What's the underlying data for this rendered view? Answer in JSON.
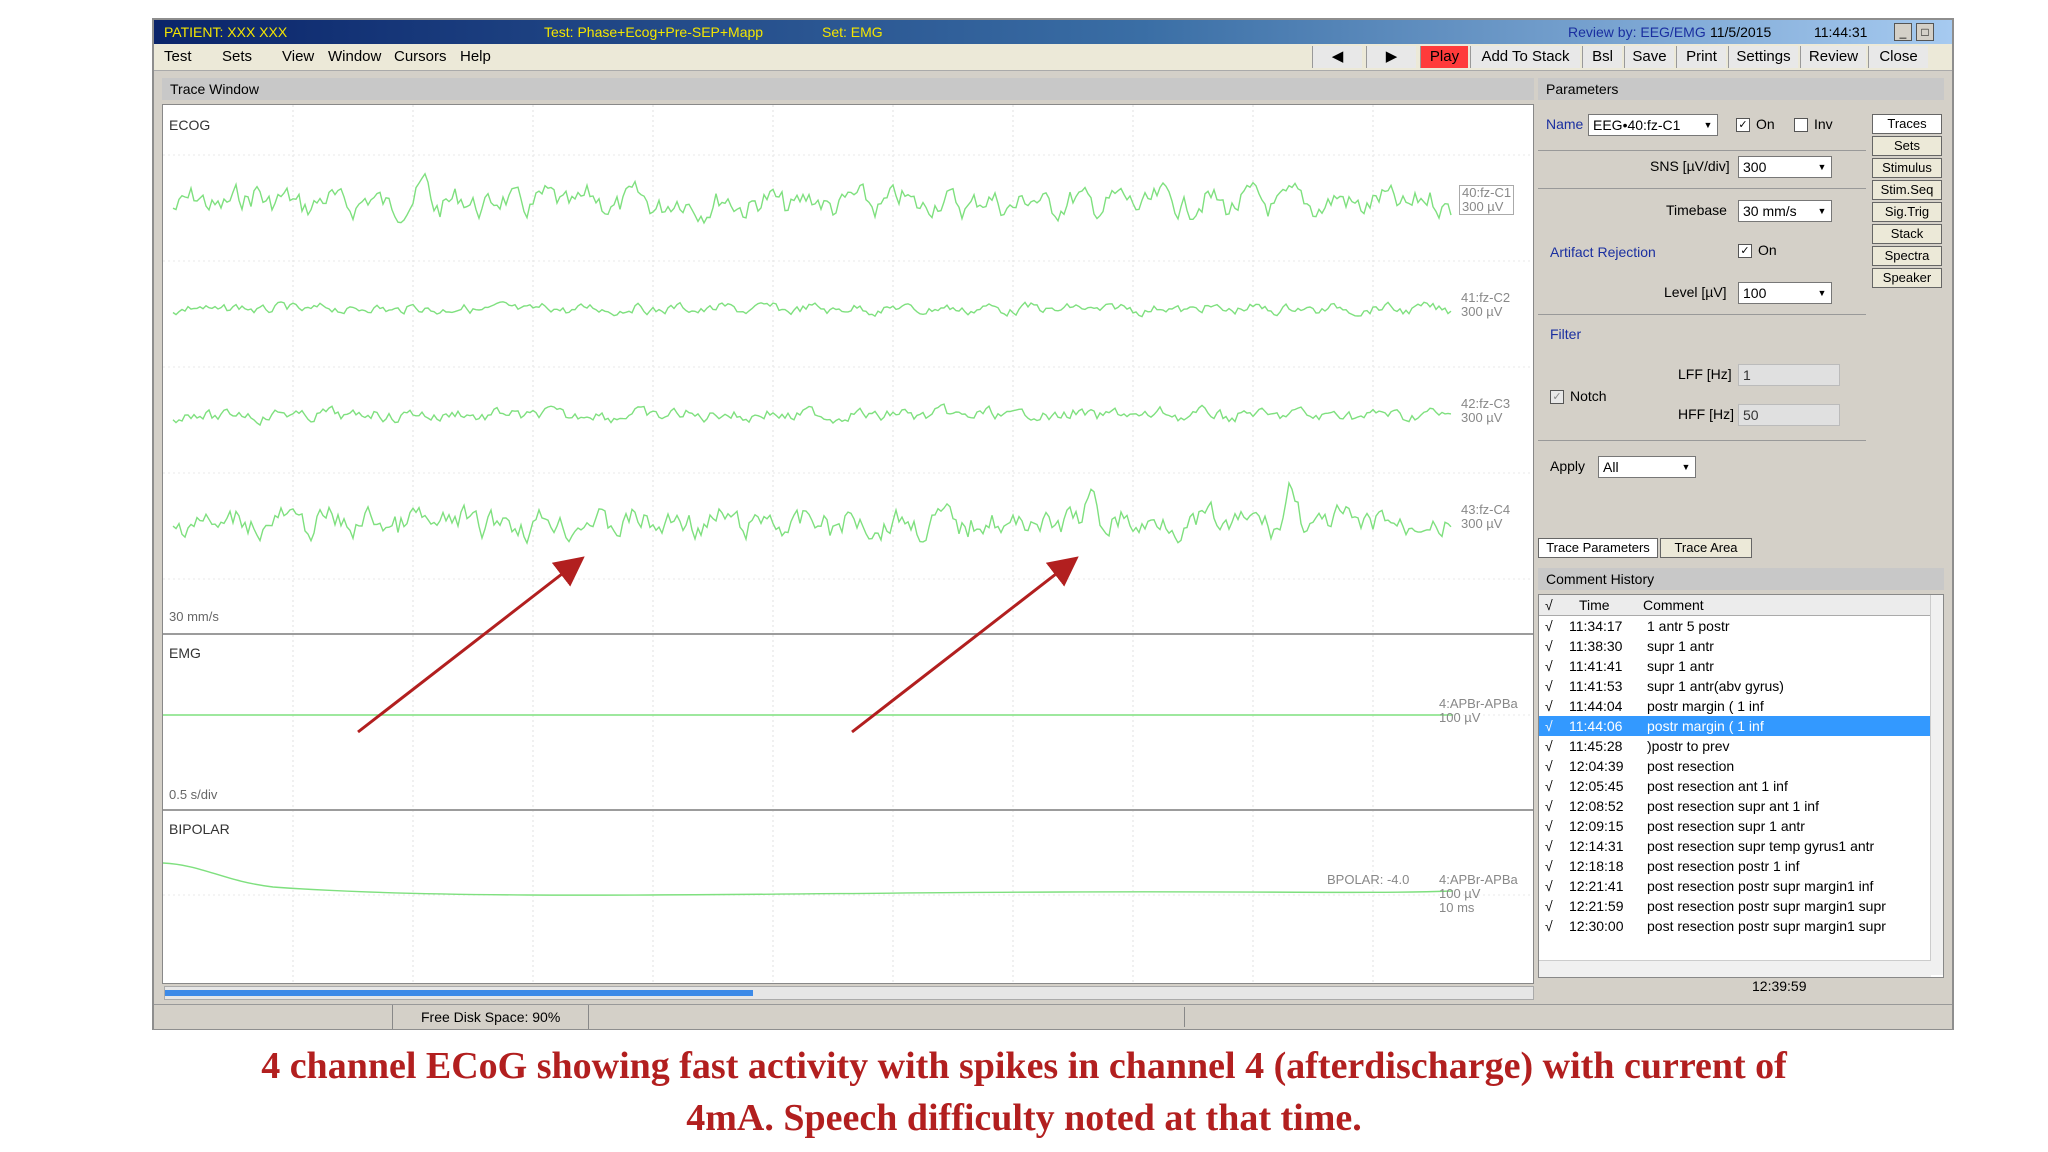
{
  "titlebar": {
    "patient": "PATIENT: XXX XXX",
    "test": "Test: Phase+Ecog+Pre-SEP+Mapp",
    "set": "Set: EMG",
    "review": "Review by: EEG/EMG",
    "date": "11/5/2015",
    "time": "11:44:31",
    "minimize": "_",
    "maximize": "□"
  },
  "menu": [
    "Test",
    "Sets",
    "View",
    "Window",
    "Cursors",
    "Help"
  ],
  "toolbar": {
    "prev": "◀",
    "next": "▶",
    "play": "Play",
    "add_to_stack": "Add To Stack",
    "bsl": "Bsl",
    "save": "Save",
    "print": "Print",
    "settings": "Settings",
    "review": "Review",
    "close": "Close"
  },
  "trace_window": {
    "header": "Trace Window",
    "ecog": {
      "label": "ECOG",
      "timebase": "30 mm/s",
      "channels": [
        {
          "name": "40:fz-C1",
          "scale": "300 µV"
        },
        {
          "name": "41:fz-C2",
          "scale": "300 µV"
        },
        {
          "name": "42:fz-C3",
          "scale": "300 µV"
        },
        {
          "name": "43:fz-C4",
          "scale": "300 µV"
        }
      ]
    },
    "emg": {
      "label": "EMG",
      "timebase": "0.5 s/div",
      "channel": {
        "name": "4:APBr-APBa",
        "scale": "100 µV"
      }
    },
    "bipolar": {
      "label": "BIPOLAR",
      "readout": "BPOLAR: -4.0",
      "channel": {
        "name": "4:APBr-APBa",
        "scale": "100 µV",
        "time": "10 ms"
      }
    }
  },
  "parameters": {
    "header": "Parameters",
    "name_label": "Name",
    "name_value": "EEG•40:fz-C1",
    "on_label": "On",
    "on_checked": "✓",
    "inv_label": "Inv",
    "sns_label": "SNS [µV/div]",
    "sns_value": "300",
    "timebase_label": "Timebase",
    "timebase_value": "30 mm/s",
    "artifact_label": "Artifact Rejection",
    "artifact_on_label": "On",
    "artifact_checked": "✓",
    "level_label": "Level [µV]",
    "level_value": "100",
    "filter_label": "Filter",
    "notch_label": "Notch",
    "notch_checked": "✓",
    "lff_label": "LFF [Hz]",
    "lff_value": "1",
    "hff_label": "HFF [Hz]",
    "hff_value": "50",
    "apply_label": "Apply",
    "apply_value": "All",
    "side_tabs": [
      "Traces",
      "Sets",
      "Stimulus",
      "Stim.Seq",
      "Sig.Trig",
      "Stack",
      "Spectra",
      "Speaker"
    ],
    "bottom_tabs": [
      "Trace Parameters",
      "Trace Area"
    ]
  },
  "comment_history": {
    "header": "Comment History",
    "col_check": "√",
    "col_time": "Time",
    "col_comment": "Comment",
    "rows": [
      {
        "check": "√",
        "time": "11:34:17",
        "comment": "1 antr 5 postr"
      },
      {
        "check": "√",
        "time": "11:38:30",
        "comment": "supr 1 antr"
      },
      {
        "check": "√",
        "time": "11:41:41",
        "comment": "supr  1 antr"
      },
      {
        "check": "√",
        "time": "11:41:53",
        "comment": "supr  1 antr(abv gyrus)"
      },
      {
        "check": "√",
        "time": "11:44:04",
        "comment": "postr margin ( 1 inf"
      },
      {
        "check": "√",
        "time": "11:44:06",
        "comment": "postr margin ( 1 inf"
      },
      {
        "check": "√",
        "time": "11:45:28",
        "comment": ")postr to prev"
      },
      {
        "check": "√",
        "time": "12:04:39",
        "comment": "post resection"
      },
      {
        "check": "√",
        "time": "12:05:45",
        "comment": "post resection ant 1 inf"
      },
      {
        "check": "√",
        "time": "12:08:52",
        "comment": "post resection supr ant 1 inf"
      },
      {
        "check": "√",
        "time": "12:09:15",
        "comment": "post resection supr  1 antr"
      },
      {
        "check": "√",
        "time": "12:14:31",
        "comment": "post resection  supr temp gyrus1 antr"
      },
      {
        "check": "√",
        "time": "12:18:18",
        "comment": "post resection  postr 1 inf"
      },
      {
        "check": "√",
        "time": "12:21:41",
        "comment": "post resection  postr supr margin1 inf"
      },
      {
        "check": "√",
        "time": "12:21:59",
        "comment": "post resection  postr supr margin1 supr"
      },
      {
        "check": "√",
        "time": "12:30:00",
        "comment": "post resection  postr supr margin1 supr"
      }
    ],
    "selected_index": 5
  },
  "status": {
    "free_disk": "Free Disk Space: 90%",
    "clock": "12:39:59",
    "progress": 0.43
  },
  "caption": {
    "line1": "4 channel ECoG showing fast activity with spikes in channel 4 (afterdischarge) with current of",
    "line2": "4mA. Speech difficulty noted at that time."
  },
  "colors": {
    "trace": "#7fe07f",
    "arrow": "#b21f1f",
    "selected_row": "#3399ff",
    "play_button": "#ff3b3b"
  }
}
